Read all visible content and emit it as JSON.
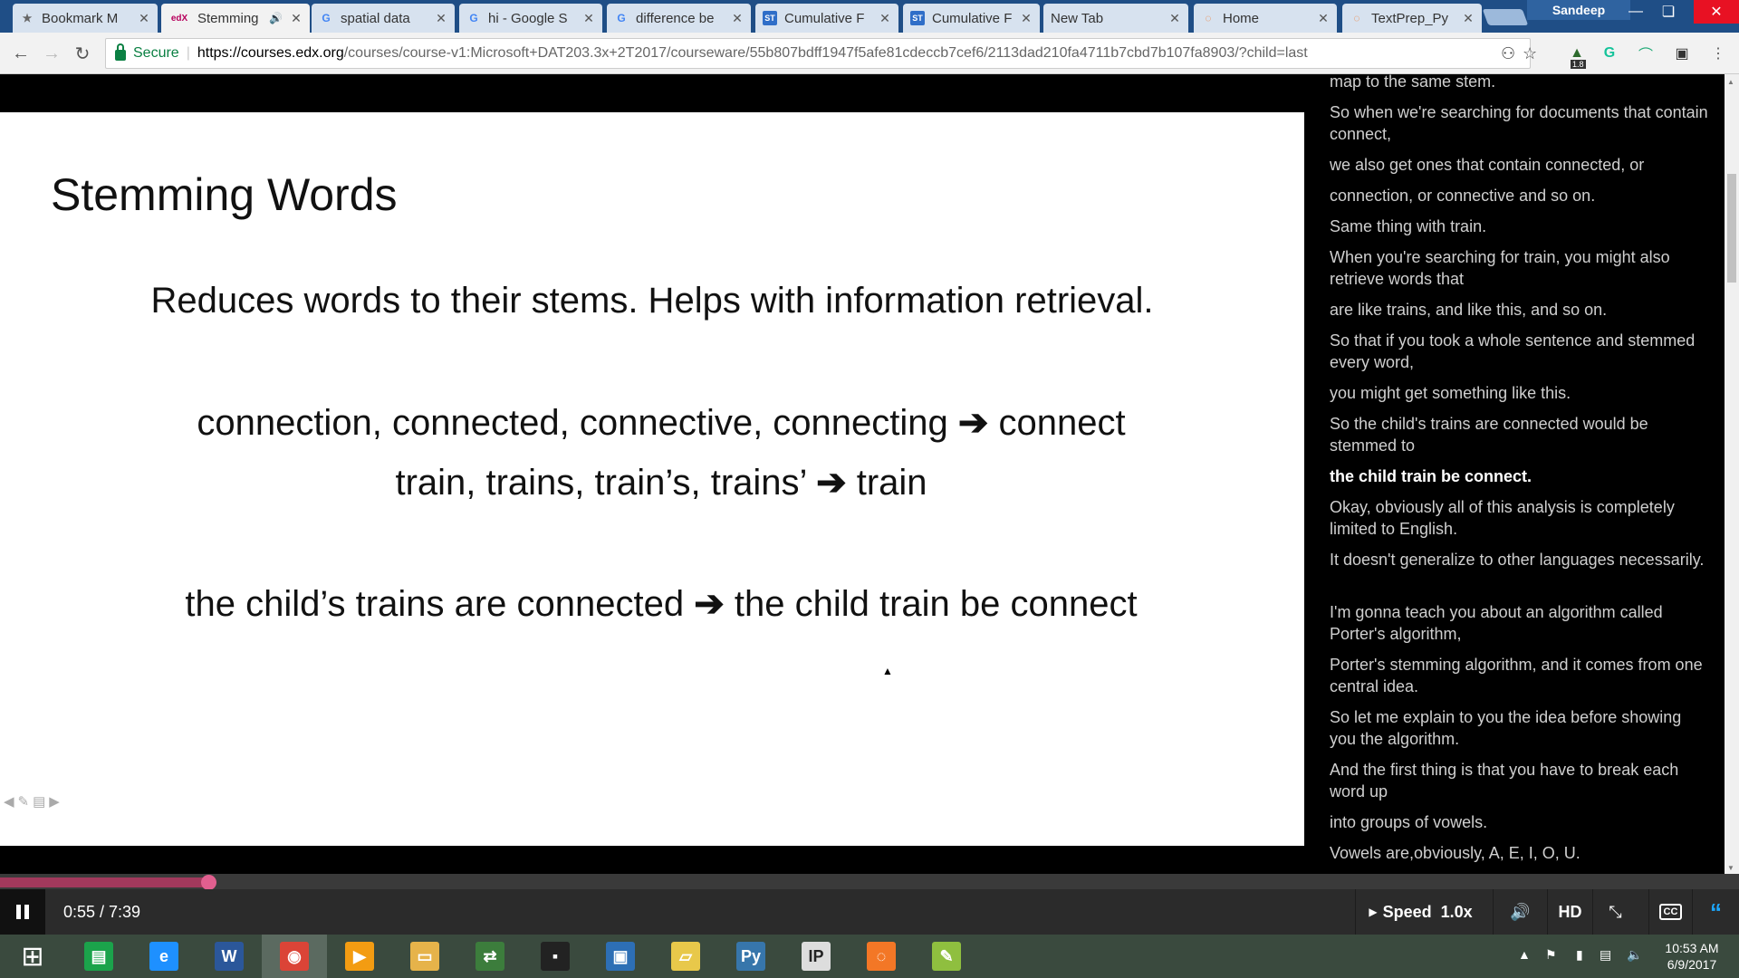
{
  "browser": {
    "profile_name": "Sandeep",
    "tabs": [
      {
        "title": "Bookmark M",
        "icon": "star-icon"
      },
      {
        "title": "Stemming",
        "icon": "edx-icon",
        "active": true,
        "audio": true
      },
      {
        "title": "spatial data",
        "icon": "google-icon"
      },
      {
        "title": "hi - Google S",
        "icon": "google-icon"
      },
      {
        "title": "difference be",
        "icon": "google-icon"
      },
      {
        "title": "Cumulative F",
        "icon": "st-icon"
      },
      {
        "title": "Cumulative F",
        "icon": "st-icon"
      },
      {
        "title": "New Tab",
        "icon": ""
      },
      {
        "title": "Home",
        "icon": "jupyter-icon"
      },
      {
        "title": "TextPrep_Py",
        "icon": "jupyter-icon"
      }
    ],
    "address": {
      "secure_label": "Secure",
      "url_host": "https://courses.edx.org",
      "url_rest": "/courses/course-v1:Microsoft+DAT203.3x+2T2017/courseware/55b807bdff1947f5afe81cdeccb7cef6/2113dad210fa4711b7cbd7b107fa8903/?child=last"
    },
    "extension_badge": "1.8"
  },
  "slide": {
    "title": "Stemming Words",
    "subtitle": "Reduces words to their stems. Helps with information retrieval.",
    "line1_left": "connection, connected, connective, connecting",
    "line1_right": "connect",
    "line2_left": "train, trains, train’s, trains’",
    "line2_right": "train",
    "line3_left": "the child’s trains are connected",
    "line3_right": "the child train be connect",
    "arrow": "➔"
  },
  "transcript": {
    "lines": [
      "map to the same stem.",
      "So when we're searching for documents that contain connect,",
      "we also get ones that contain connected, or",
      "connection, or connective and so on.",
      "Same thing with train.",
      "When you're searching for train, you might also retrieve words that",
      "are like trains, and like this, and so on.",
      "So that if you took a whole sentence and stemmed every word,",
      "you might get something like this.",
      "So the child's trains are connected would be stemmed to",
      "the child train be connect.",
      "Okay, obviously all of this analysis is completely limited to English.",
      "It doesn't generalize to other languages necessarily.",
      "I'm gonna teach you about an algorithm called Porter's algorithm,",
      "Porter's stemming algorithm, and it comes from one central idea.",
      "So let me explain to you the idea before showing you the algorithm.",
      "And the first thing is that you have to break each word up",
      "into groups of vowels.",
      "Vowels are,obviously, A, E, I, O, U."
    ],
    "current_index": 10
  },
  "player": {
    "time": "0:55 / 7:39",
    "progress_fraction": 0.1198,
    "speed_label": "Speed",
    "speed_value": "1.0x",
    "hd_label": "HD",
    "cc_label": "CC",
    "accent_color": "#e15f8f",
    "transcript_toggle_color": "#1ca8ff"
  },
  "taskbar": {
    "apps": [
      "windows-start-icon",
      "store-icon",
      "internet-explorer-icon",
      "word-icon",
      "chrome-icon",
      "media-player-icon",
      "file-explorer-icon",
      "network-tool-icon",
      "terminal-icon",
      "remote-desktop-icon",
      "folder-icon",
      "python-icon",
      "ipython-icon",
      "jupyter-icon",
      "paint-icon"
    ],
    "clock_time": "10:53 AM",
    "clock_date": "6/9/2017"
  }
}
